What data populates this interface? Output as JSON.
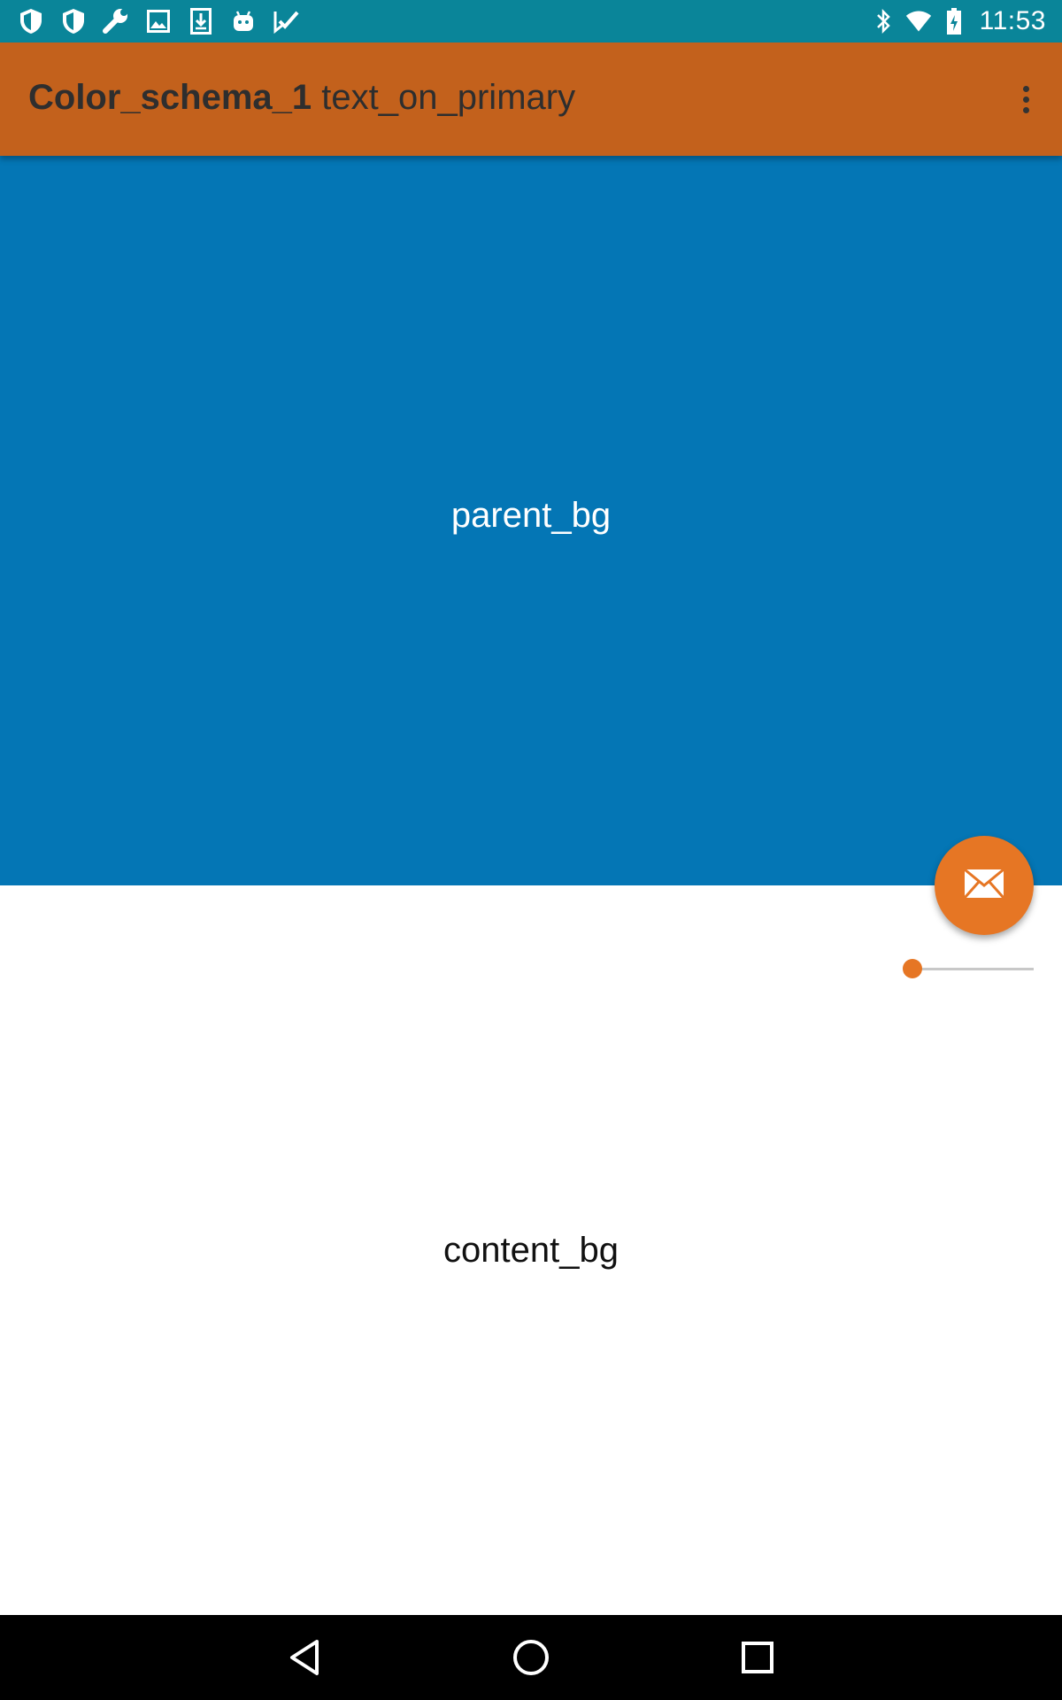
{
  "status_bar": {
    "left_icons": [
      "shield-icon",
      "shield-icon",
      "wrench-icon",
      "image-icon",
      "download-icon",
      "android-icon",
      "check-icon"
    ],
    "right_icons": [
      "bluetooth-icon",
      "wifi-icon",
      "battery-icon"
    ],
    "time": "11:53"
  },
  "app_bar": {
    "title_strong": "Color_schema_1",
    "title_rest": "text_on_primary",
    "menu_icon": "more-vert-icon"
  },
  "parent_area": {
    "label": "parent_bg"
  },
  "content_area": {
    "label": "content_bg"
  },
  "fab": {
    "icon": "mail-icon"
  },
  "slider": {
    "value": 0
  },
  "nav_bar": {
    "buttons": [
      "back-icon",
      "home-icon",
      "recents-icon"
    ]
  },
  "colors": {
    "status_bar": "#0a8599",
    "primary": "#c3611c",
    "parent_bg": "#0476b5",
    "accent": "#e67624",
    "content_bg": "#ffffff"
  }
}
